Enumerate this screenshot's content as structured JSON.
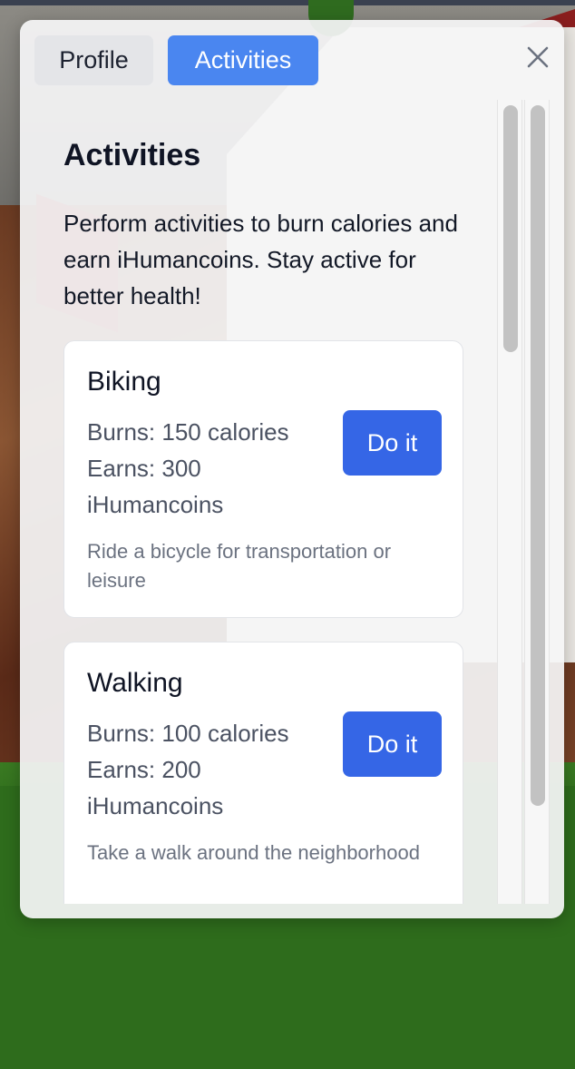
{
  "tabs": {
    "profile_label": "Profile",
    "activities_label": "Activities",
    "active": "Activities"
  },
  "close_icon": "close-icon",
  "main": {
    "title": "Activities",
    "intro": "Perform activities to burn calories and earn iHumancoins. Stay active for better health!"
  },
  "activities": [
    {
      "name": "Biking",
      "burns": "Burns: 150 calories",
      "earns_line1": "Earns: 300",
      "earns_line2": "iHumancoins",
      "description": "Ride a bicycle for transportation or leisure",
      "button_label": "Do it"
    },
    {
      "name": "Walking",
      "burns": "Burns: 100 calories",
      "earns_line1": "Earns: 200",
      "earns_line2": "iHumancoins",
      "description": "Take a walk around the neighborhood",
      "button_label": "Do it"
    }
  ],
  "colors": {
    "active_tab": "#4a86f0",
    "button": "#3566e6",
    "panel": "#f5f5f6"
  }
}
